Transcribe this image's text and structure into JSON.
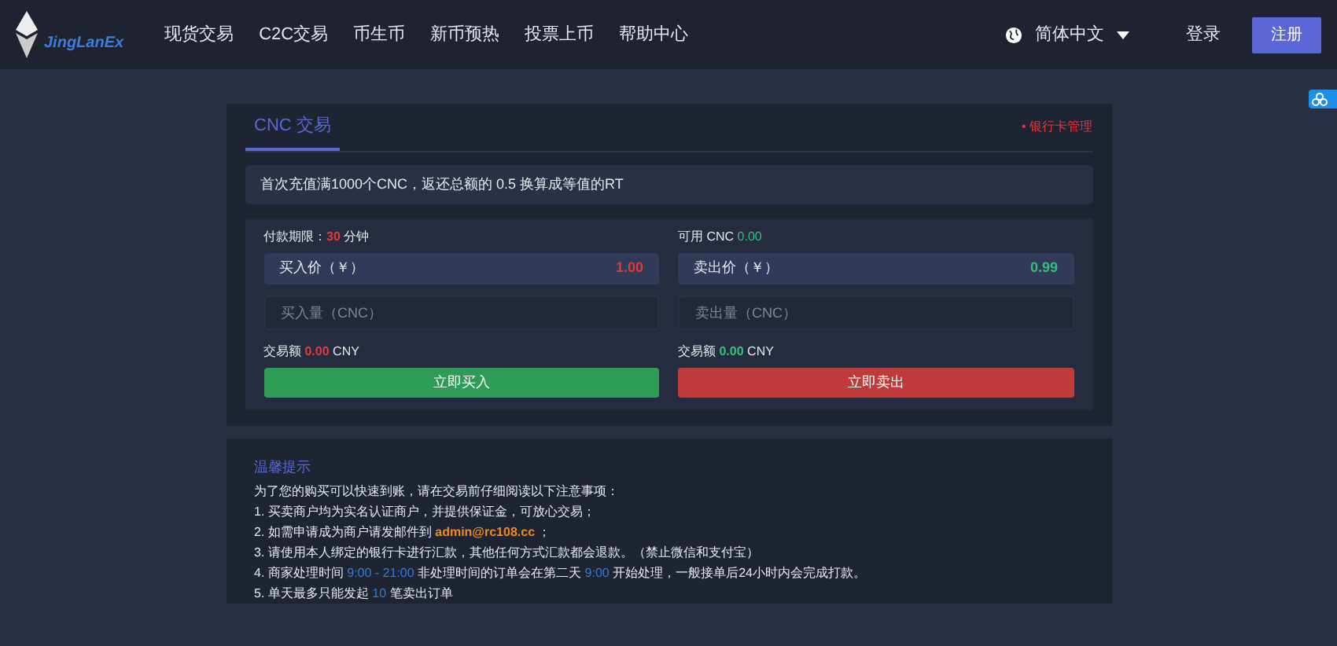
{
  "header": {
    "logo_text": "JingLanEx",
    "nav": [
      "现货交易",
      "C2C交易",
      "币生币",
      "新币预热",
      "投票上币",
      "帮助中心"
    ],
    "language": "简体中文",
    "login": "登录",
    "register": "注册"
  },
  "trade": {
    "tab": {
      "label": "CNC 交易",
      "selected": true
    },
    "bank_link": "• 银行卡管理",
    "notice": "首次充值满1000个CNC，返还总额的 0.5 换算成等值的RT",
    "buy": {
      "limit_label": "付款期限：",
      "limit_value": "30",
      "limit_unit": "分钟",
      "price_label": "买入价（￥）",
      "price": "1.00",
      "amount_placeholder": "买入量（CNC）",
      "total_label": "交易额",
      "total": "0.00",
      "total_unit": "CNY",
      "button": "立即买入"
    },
    "sell": {
      "avail_label": "可用 CNC",
      "avail_value": "0.00",
      "price_label": "卖出价（￥）",
      "price": "0.99",
      "amount_placeholder": "卖出量（CNC）",
      "total_label": "交易额",
      "total": "0.00",
      "total_unit": "CNY",
      "button": "立即卖出"
    }
  },
  "tips": {
    "title": "温馨提示",
    "lines": [
      [
        {
          "kind": "plain",
          "text": "为了您的购买可以快速到账，请在交易前仔细阅读以下注意事项："
        }
      ],
      [
        {
          "kind": "plain",
          "text": "1. 买卖商户均为实名认证商户，并提供保证金，可放心交易；"
        }
      ],
      [
        {
          "kind": "plain",
          "text": "2. 如需申请成为商户请发邮件到 "
        },
        {
          "kind": "email",
          "text": "admin@rc108.cc"
        },
        {
          "kind": "plain",
          "text": " ；"
        }
      ],
      [
        {
          "kind": "plain",
          "text": "3. 请使用本人绑定的银行卡进行汇款，其他任何方式汇款都会退款。（禁止微信和支付宝）"
        }
      ],
      [
        {
          "kind": "plain",
          "text": "4. 商家处理时间 "
        },
        {
          "kind": "time",
          "text": "9:00 - 21:00"
        },
        {
          "kind": "plain",
          "text": " 非处理时间的订单会在第二天 "
        },
        {
          "kind": "time",
          "text": "9:00"
        },
        {
          "kind": "plain",
          "text": " 开始处理，一般接单后24小时内会完成打款。"
        }
      ],
      [
        {
          "kind": "plain",
          "text": "5. 单天最多只能发起 "
        },
        {
          "kind": "time",
          "text": "10"
        },
        {
          "kind": "plain",
          "text": " 笔卖出订单"
        }
      ]
    ]
  }
}
